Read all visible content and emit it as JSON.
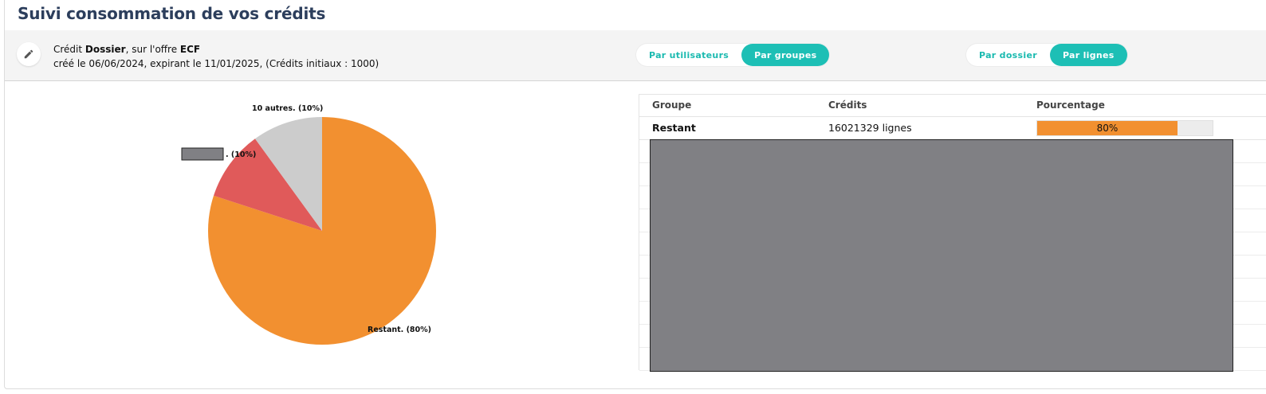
{
  "header": {
    "title": "Suivi consommation de vos crédits"
  },
  "credit_info": {
    "edit_icon": "pencil-icon",
    "line1_prefix": "Crédit ",
    "line1_type": "Dossier",
    "line1_middle": ", sur l'offre ",
    "line1_offer": "ECF",
    "line2": "créé le 06/06/2024, expirant le 11/01/2025, (Crédits initiaux : 1000)"
  },
  "toggles": {
    "grouping": {
      "options": [
        "Par utilisateurs",
        "Par groupes"
      ],
      "active": "Par groupes"
    },
    "scope": {
      "options": [
        "Par dossier",
        "Par lignes"
      ],
      "active": "Par lignes"
    }
  },
  "colors": {
    "accent": "#1dbfb5",
    "title": "#2c3e5c",
    "restant": "#f29030",
    "redacted_group": "#e05a5a",
    "others": "#cccccc",
    "redaction": "#808084"
  },
  "chart_data": {
    "type": "pie",
    "slices": [
      {
        "label": "Restant. (80%)",
        "value": 80,
        "color": "#f29030"
      },
      {
        "label": ". (10%)",
        "value": 10,
        "color": "#e05a5a"
      },
      {
        "label": "10 autres. (10%)",
        "value": 10,
        "color": "#cccccc"
      }
    ]
  },
  "table": {
    "headers": {
      "group": "Groupe",
      "credits": "Crédits",
      "percent": "Pourcentage"
    },
    "rows": [
      {
        "group": "Restant",
        "credits": "16021329 lignes",
        "percent_text": "80%",
        "percent": 80
      }
    ]
  }
}
